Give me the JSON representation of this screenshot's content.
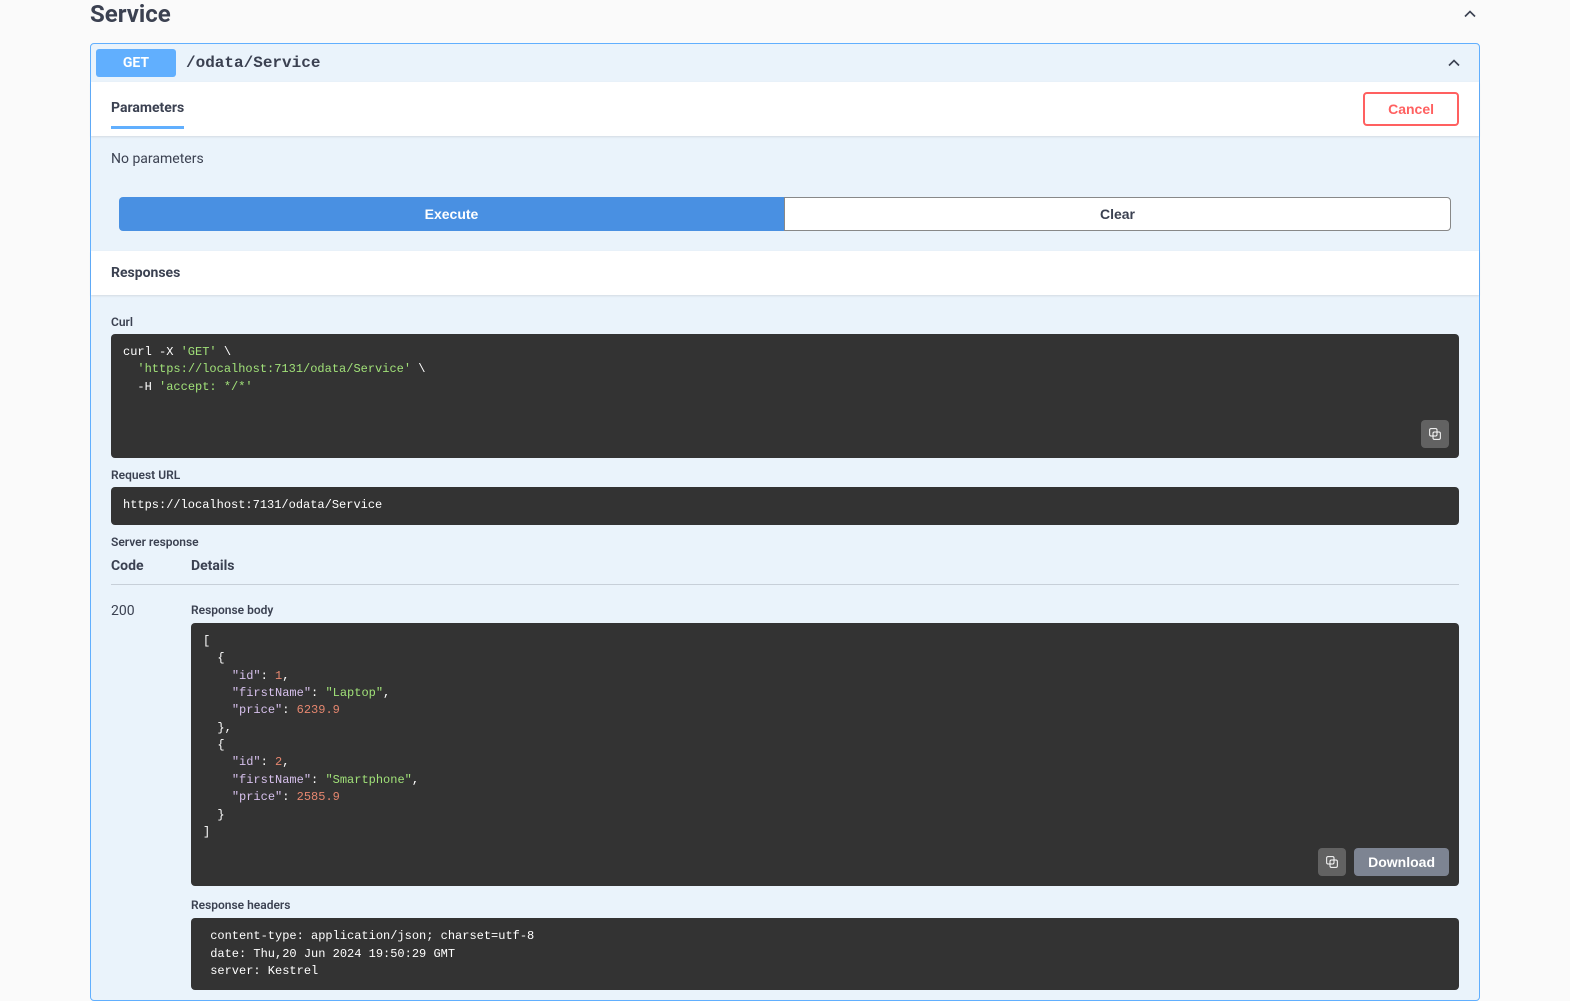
{
  "section": {
    "title": "Service"
  },
  "op": {
    "method": "GET",
    "path": "/odata/Service"
  },
  "params": {
    "tab_label": "Parameters",
    "cancel_label": "Cancel",
    "none_text": "No parameters",
    "execute_label": "Execute",
    "clear_label": "Clear"
  },
  "responses": {
    "header": "Responses",
    "curl_label": "Curl",
    "curl": {
      "prefix": "curl -X ",
      "method": "'GET'",
      "slash1": " \\",
      "url_line_indent": "  ",
      "url": "'https://localhost:7131/odata/Service'",
      "slash2": " \\",
      "h_line_indent": "  -H ",
      "accept": "'accept: */*'"
    },
    "request_url_label": "Request URL",
    "request_url": "https://localhost:7131/odata/Service",
    "server_response_label": "Server response",
    "code_col": "Code",
    "details_col": "Details",
    "status_code": "200",
    "response_body_label": "Response body",
    "body_items": [
      {
        "id": 1,
        "firstName": "Laptop",
        "price": 6239.9
      },
      {
        "id": 2,
        "firstName": "Smartphone",
        "price": 2585.9
      }
    ],
    "response_headers_label": "Response headers",
    "headers_text": " content-type: application/json; charset=utf-8 \n date: Thu,20 Jun 2024 19:50:29 GMT \n server: Kestrel ",
    "download_label": "Download"
  }
}
